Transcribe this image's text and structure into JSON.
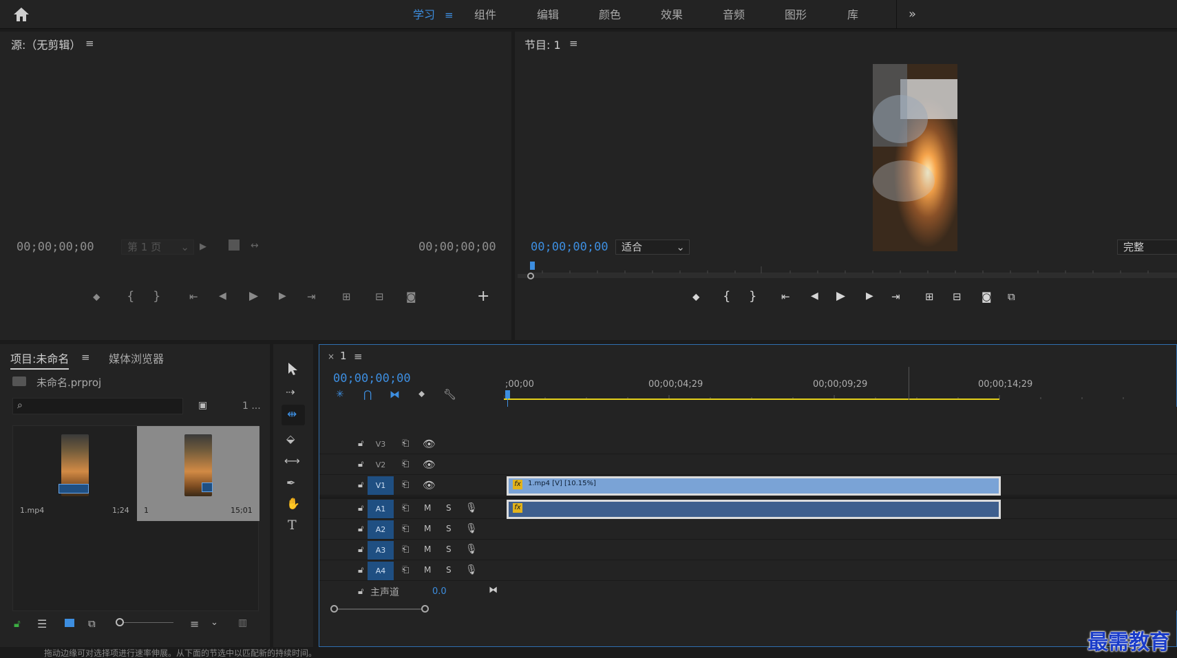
{
  "workspace": {
    "tabs": [
      "学习",
      "组件",
      "编辑",
      "颜色",
      "效果",
      "音频",
      "图形",
      "库"
    ],
    "active_tab": "学习",
    "more_label": "»"
  },
  "source": {
    "title": "源:（无剪辑）",
    "timecode_in": "00;00;00;00",
    "timecode_out": "00;00;00;00",
    "page_select": "第 1 页"
  },
  "program": {
    "title": "节目: 1",
    "timecode": "00;00;00;00",
    "fit_select": "适合",
    "quality_select": "完整"
  },
  "project": {
    "tab_project": "项目:未命名",
    "tab_media": "媒体浏览器",
    "file_name": "未命名.prproj",
    "search_placeholder": "",
    "count_label": "1 ...",
    "items": [
      {
        "name": "1.mp4",
        "duration": "1;24"
      },
      {
        "name": "1",
        "duration": "15;01"
      }
    ]
  },
  "timeline": {
    "sequence_name": "1",
    "timecode": "00;00;00;00",
    "ruler": [
      ";00;00",
      "00;00;04;29",
      "00;00;09;29",
      "00;00;14;29"
    ],
    "video_tracks": [
      "V3",
      "V2",
      "V1"
    ],
    "audio_tracks": [
      "A1",
      "A2",
      "A3",
      "A4"
    ],
    "master_label": "主声道",
    "master_value": "0.0",
    "mute_label": "M",
    "solo_label": "S",
    "clip_video_label": "1.mp4 [V] [10.15%]",
    "fx_label": "fx"
  },
  "footer": {
    "hint": "拖动边缘可对选择项进行速率伸展。从下面的节选中以匹配新的持续时间。"
  },
  "watermark": "最需教育",
  "colors": {
    "accent": "#3d8ee0",
    "clip_video": "#7aa3d6",
    "clip_audio": "#3f5f8e",
    "track_selected": "#1f4f82"
  }
}
